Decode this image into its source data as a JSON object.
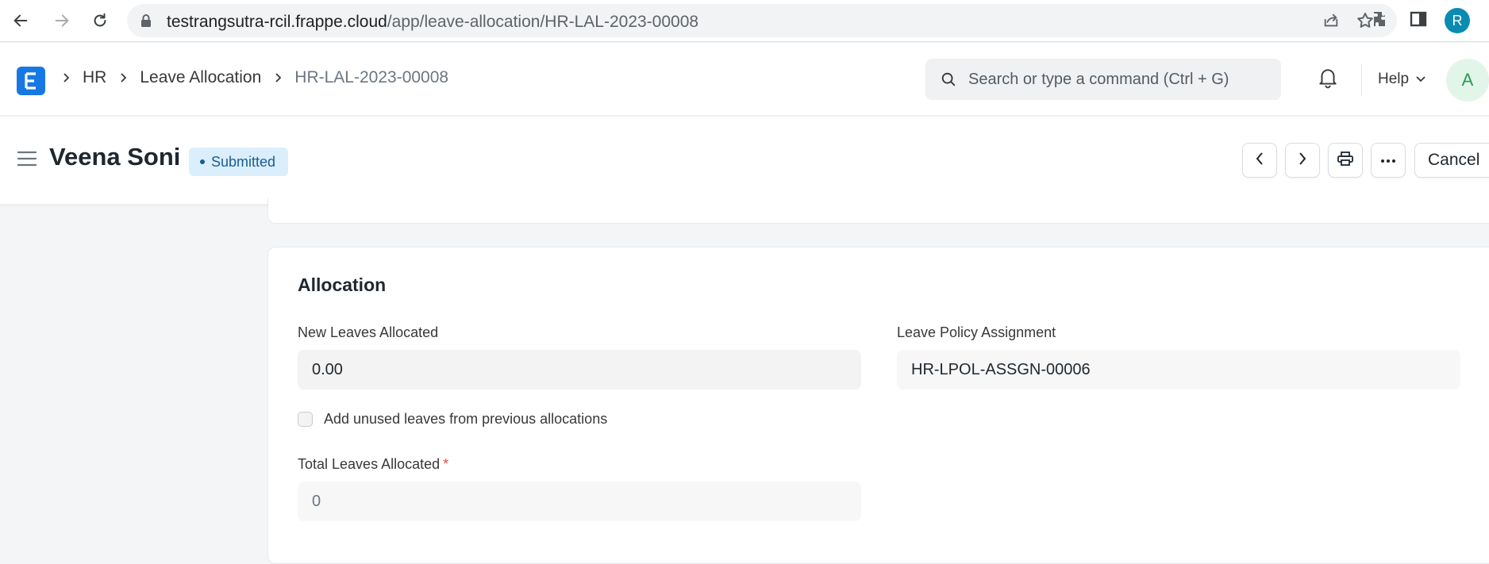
{
  "browser": {
    "url_host": "testrangsutra-rcil.frappe.cloud",
    "url_path": "/app/leave-allocation/HR-LAL-2023-00008",
    "profile_initial": "R"
  },
  "navbar": {
    "breadcrumbs": [
      {
        "label": "HR"
      },
      {
        "label": "Leave Allocation"
      },
      {
        "label": "HR-LAL-2023-00008"
      }
    ],
    "search_placeholder": "Search or type a command (Ctrl + G)",
    "help_label": "Help",
    "avatar_initial": "A"
  },
  "page": {
    "title": "Veena Soni",
    "status": "Submitted",
    "cancel_label": "Cancel"
  },
  "section": {
    "title": "Allocation",
    "new_leaves_label": "New Leaves Allocated",
    "new_leaves_value": "0.00",
    "policy_label": "Leave Policy Assignment",
    "policy_value": "HR-LPOL-ASSGN-00006",
    "carry_forward_label": "Add unused leaves from previous allocations",
    "carry_forward_checked": false,
    "total_label": "Total Leaves Allocated",
    "total_required_mark": "*",
    "total_value": "0"
  },
  "colors": {
    "brand": "#1778e5",
    "status_bg": "#dbeefc",
    "status_text": "#1b5c91",
    "required": "#e24c4c"
  }
}
